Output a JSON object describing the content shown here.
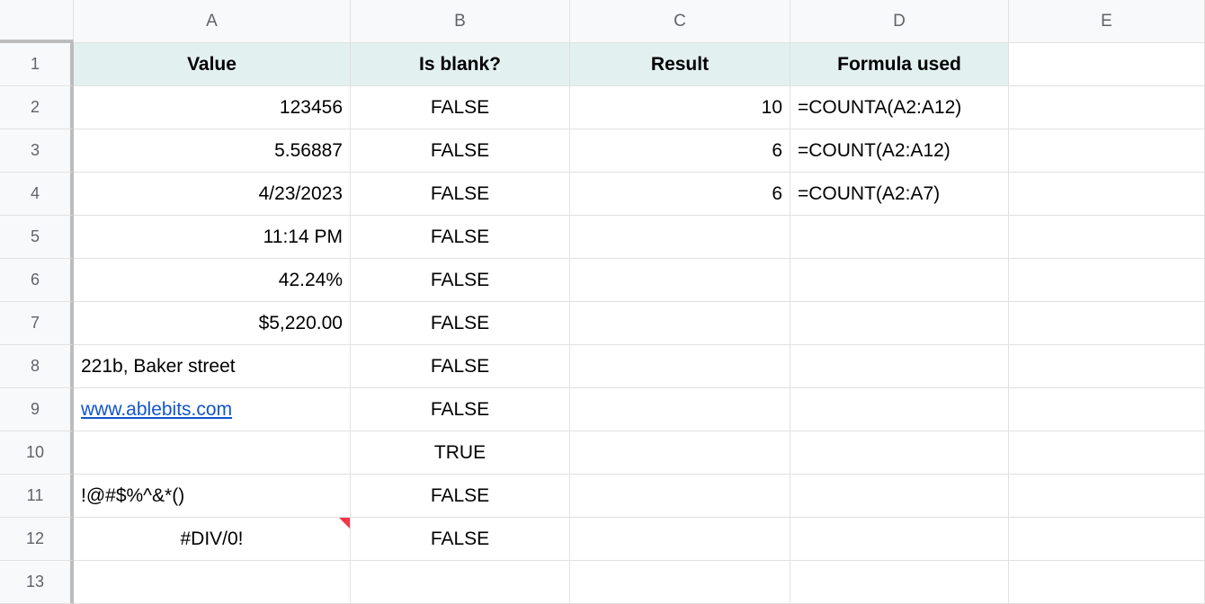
{
  "columns": [
    "A",
    "B",
    "C",
    "D",
    "E"
  ],
  "rowNumbers": [
    "1",
    "2",
    "3",
    "4",
    "5",
    "6",
    "7",
    "8",
    "9",
    "10",
    "11",
    "12",
    "13"
  ],
  "headers": {
    "A": "Value",
    "B": "Is blank?",
    "C": "Result",
    "D": "Formula used"
  },
  "rows": [
    {
      "A": "123456",
      "B": "FALSE",
      "C": "10",
      "D": "=COUNTA(A2:A12)"
    },
    {
      "A": "5.56887",
      "B": "FALSE",
      "C": "6",
      "D": "=COUNT(A2:A12)"
    },
    {
      "A": "4/23/2023",
      "B": "FALSE",
      "C": "6",
      "D": "=COUNT(A2:A7)"
    },
    {
      "A": "11:14 PM",
      "B": "FALSE",
      "C": "",
      "D": ""
    },
    {
      "A": "42.24%",
      "B": "FALSE",
      "C": "",
      "D": ""
    },
    {
      "A": "$5,220.00",
      "B": "FALSE",
      "C": "",
      "D": ""
    },
    {
      "A": "221b, Baker street",
      "B": "FALSE",
      "C": "",
      "D": "",
      "A_left": true
    },
    {
      "A": "www.ablebits.com",
      "B": "FALSE",
      "C": "",
      "D": "",
      "A_link": true,
      "A_left": true
    },
    {
      "A": "",
      "B": "TRUE",
      "C": "",
      "D": ""
    },
    {
      "A": "!@#$%^&*()",
      "B": "FALSE",
      "C": "",
      "D": "",
      "A_left": true
    },
    {
      "A": "#DIV/0!",
      "B": "FALSE",
      "C": "",
      "D": "",
      "A_center": true,
      "A_note": true
    },
    {
      "A": "",
      "B": "",
      "C": "",
      "D": ""
    }
  ]
}
